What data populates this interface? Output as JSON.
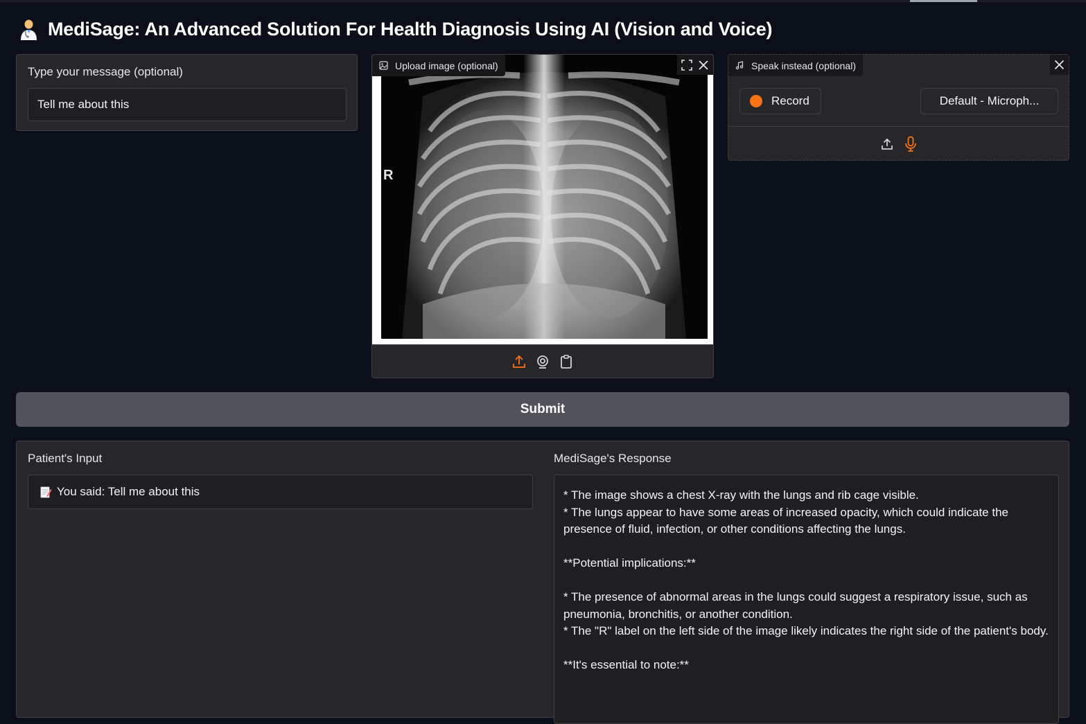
{
  "header": {
    "title": "MediSage: An Advanced Solution For Health Diagnosis Using AI (Vision and Voice)",
    "emoji": "health-worker-emoji"
  },
  "message": {
    "label": "Type your message (optional)",
    "value": "Tell me about this"
  },
  "image_upload": {
    "label": "Upload image (optional)",
    "image_marker": "R"
  },
  "audio": {
    "label": "Speak instead (optional)",
    "record_label": "Record",
    "device_selected": "Default - Microph..."
  },
  "submit_label": "Submit",
  "output": {
    "input_label": "Patient's Input",
    "input_text": "You said: Tell me about this",
    "response_label": "MediSage's Response",
    "response_lines": [
      "*   The image shows a chest X-ray with the lungs and rib cage visible.",
      "*   The lungs appear to have some areas of increased opacity, which could indicate the presence of fluid, infection, or other conditions affecting the lungs.",
      "",
      "**Potential implications:**",
      "",
      "*   The presence of abnormal areas in the lungs could suggest a respiratory issue, such as pneumonia, bronchitis, or another condition.",
      "*   The \"R\" label on the left side of the image likely indicates the right side of the patient's body.",
      "",
      "**It's essential to note:**"
    ]
  },
  "colors": {
    "background": "#0b0f19",
    "panel": "#27272a",
    "accent": "#f97316",
    "submit": "#52525b"
  }
}
